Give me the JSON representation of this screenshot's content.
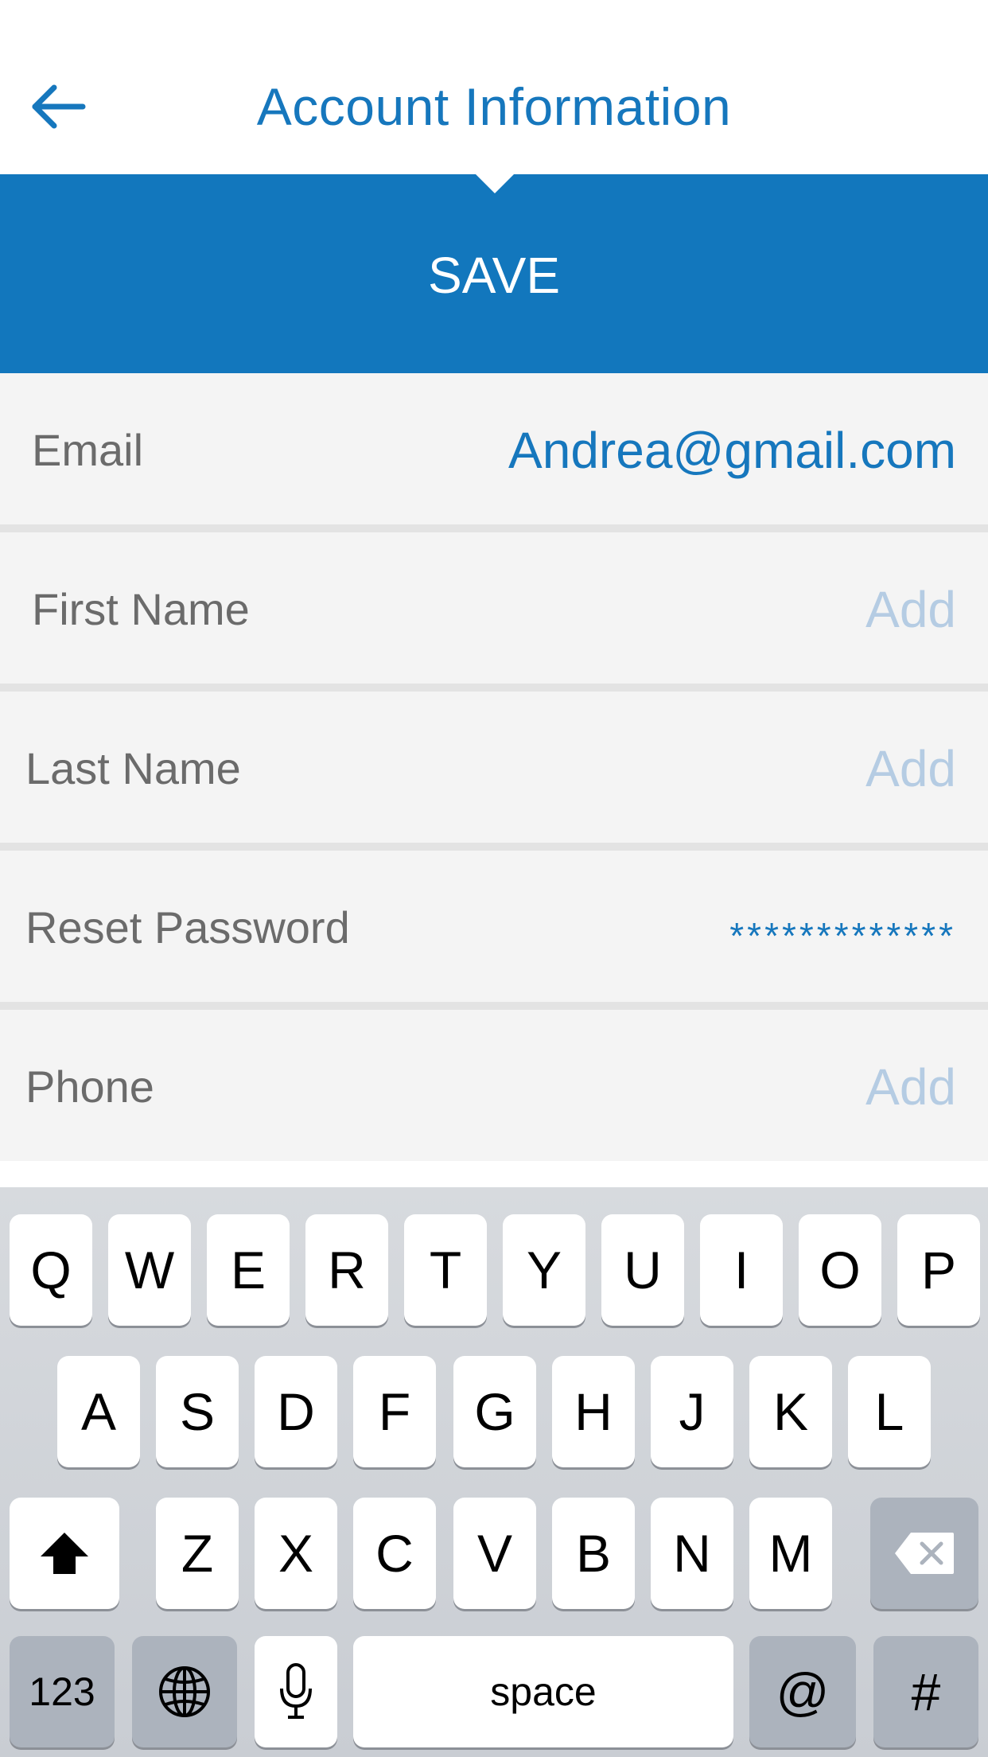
{
  "header": {
    "title": "Account Information",
    "back_icon": "arrow-left-icon"
  },
  "save_label": "SAVE",
  "form": {
    "rows": [
      {
        "label": "Email",
        "value": "Andrea@gmail.com"
      },
      {
        "label": "First Name",
        "value": "Add"
      },
      {
        "label": "Last Name",
        "value": "Add"
      },
      {
        "label": "Reset Password",
        "value": "*************"
      },
      {
        "label": "Phone",
        "value": "Add"
      }
    ]
  },
  "keyboard": {
    "row1": [
      "Q",
      "W",
      "E",
      "R",
      "T",
      "Y",
      "U",
      "I",
      "O",
      "P"
    ],
    "row2": [
      "A",
      "S",
      "D",
      "F",
      "G",
      "H",
      "J",
      "K",
      "L"
    ],
    "row3": [
      "Z",
      "X",
      "C",
      "V",
      "B",
      "N",
      "M"
    ],
    "shift_icon": "shift-arrow-icon",
    "delete_icon": "backspace-icon",
    "numbers_label": "123",
    "globe_icon": "globe-icon",
    "mic_icon": "microphone-icon",
    "space_label": "space",
    "at_label": "@",
    "hash_label": "#"
  },
  "colors": {
    "accent": "#1277bd",
    "title": "#1677bd",
    "placeholder": "#b5cce3",
    "row_bg": "#f4f4f4"
  }
}
